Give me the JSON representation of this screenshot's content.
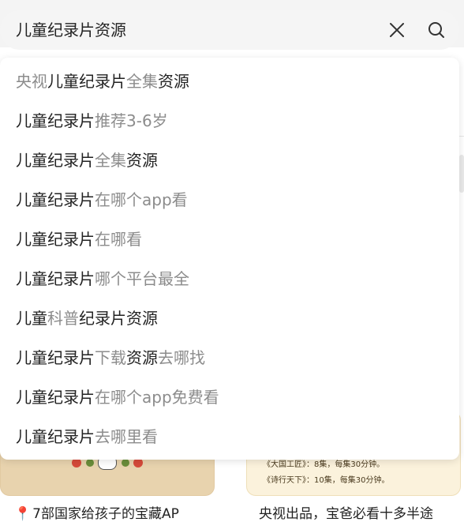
{
  "search": {
    "query": "儿童纪录片资源"
  },
  "icons": {
    "clear": "close-icon",
    "search": "search-icon"
  },
  "colors": {
    "matched_text": "#222222",
    "unmatched_text": "#8c8c8c",
    "search_bg": "#f5f5f5"
  },
  "suggestions": [
    {
      "segments": [
        {
          "t": "央视",
          "hl": false
        },
        {
          "t": "儿童纪录片",
          "hl": true
        },
        {
          "t": "全集",
          "hl": false
        },
        {
          "t": "资源",
          "hl": true
        }
      ]
    },
    {
      "segments": [
        {
          "t": "儿童纪录片",
          "hl": true
        },
        {
          "t": "推荐3-6岁",
          "hl": false
        }
      ]
    },
    {
      "segments": [
        {
          "t": "儿童纪录片",
          "hl": true
        },
        {
          "t": "全集",
          "hl": false
        },
        {
          "t": "资源",
          "hl": true
        }
      ]
    },
    {
      "segments": [
        {
          "t": "儿童纪录片",
          "hl": true
        },
        {
          "t": "在哪个app看",
          "hl": false
        }
      ]
    },
    {
      "segments": [
        {
          "t": "儿童纪录片",
          "hl": true
        },
        {
          "t": "在哪看",
          "hl": false
        }
      ]
    },
    {
      "segments": [
        {
          "t": "儿童纪录片",
          "hl": true
        },
        {
          "t": "哪个平台最全",
          "hl": false
        }
      ]
    },
    {
      "segments": [
        {
          "t": "儿童",
          "hl": true
        },
        {
          "t": "科普",
          "hl": false
        },
        {
          "t": "纪录片资源",
          "hl": true
        }
      ]
    },
    {
      "segments": [
        {
          "t": "儿童纪录片",
          "hl": true
        },
        {
          "t": "下载",
          "hl": false
        },
        {
          "t": "资源",
          "hl": true
        },
        {
          "t": "去哪找",
          "hl": false
        }
      ]
    },
    {
      "segments": [
        {
          "t": "儿童纪录片",
          "hl": true
        },
        {
          "t": "在哪个app免费看",
          "hl": false
        }
      ]
    },
    {
      "segments": [
        {
          "t": "儿童纪录片",
          "hl": true
        },
        {
          "t": "去哪里看",
          "hl": false
        }
      ]
    }
  ],
  "background_cards": {
    "left_title": "7部国家给孩子的宝藏AP",
    "right_title": "央视出品，宝爸必看十多半途",
    "right_line1": "《大国工匠》：8集，每集30分钟。",
    "right_line2": "《诗行天下》：10集，每集30分钟。"
  }
}
